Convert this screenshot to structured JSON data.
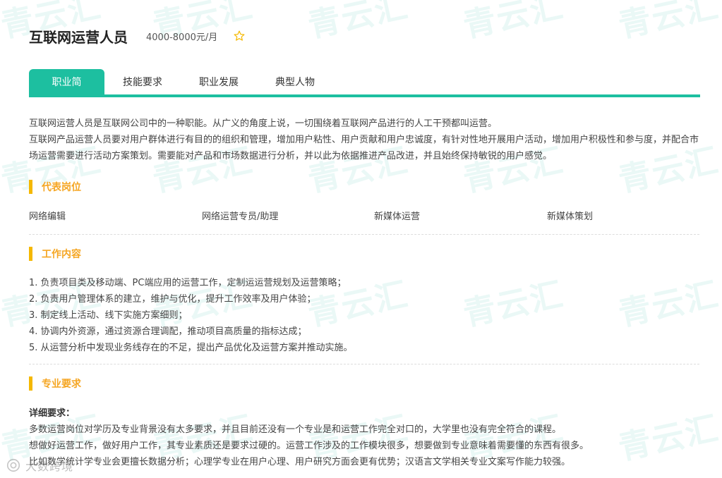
{
  "header": {
    "title": "互联网运营人员",
    "salary": "4000-8000元/月",
    "favorite_icon": "star-outline-icon"
  },
  "tabs": [
    {
      "label": "职业简介",
      "active": true
    },
    {
      "label": "技能要求",
      "active": false
    },
    {
      "label": "职业发展",
      "active": false
    },
    {
      "label": "典型人物",
      "active": false
    }
  ],
  "intro": {
    "line1": "互联网运营人员是互联网公司中的一种职能。从广义的角度上说，一切围绕着互联网产品进行的人工干预都叫运营。",
    "line2": "互联网产品运营人员要对用户群体进行有目的的组织和管理，增加用户粘性、用户贡献和用户忠诚度，有针对性地开展用户活动，增加用户积极性和参与度，并配合市场运营需要进行活动方案策划。需要能对产品和市场数据进行分析，并以此为依据推进产品改进，并且始终保持敏锐的用户感觉。"
  },
  "sections": {
    "positions_title": "代表岗位",
    "work_title": "工作内容",
    "major_title": "专业要求"
  },
  "positions": [
    "网络编辑",
    "网络运营专员/助理",
    "新媒体运营",
    "新媒体策划"
  ],
  "work_items": [
    "1. 负责项目类及移动端、PC端应用的运营工作，定制运运营规划及运营策略；",
    "2. 负责用户管理体系的建立，维护与优化，提升工作效率及用户体验；",
    "3. 制定线上活动、线下实施方案细则；",
    "4. 协调内外资源，通过资源合理调配，推动项目高质量的指标达成；",
    "5. 从运营分析中发现业务线存在的不足，提出产品优化及运营方案并推动实施。"
  ],
  "requirements": {
    "label": "详细要求：",
    "lines": [
      "多数运营岗位对学历及专业背景没有太多要求，并且目前还没有一个专业是和运营工作完全对口的，大学里也没有完全符合的课程。",
      "想做好运营工作，做好用户工作，其专业素质还是要求过硬的。运营工作涉及的工作模块很多，想要做到专业意味着需要懂的东西有很多。",
      "比如数学统计学专业会更擅长数据分析；心理学专业在用户心理、用户研究方面会更有优势；汉语言文学相关专业文案写作能力较强。"
    ]
  },
  "watermark": {
    "text": "青云汇",
    "corner_text": "大数跨境",
    "corner_icon": "brand-logo-icon"
  },
  "colors": {
    "accent": "#1dbfa0",
    "section_bar": "#f5b800",
    "section_title": "#f5a623"
  }
}
